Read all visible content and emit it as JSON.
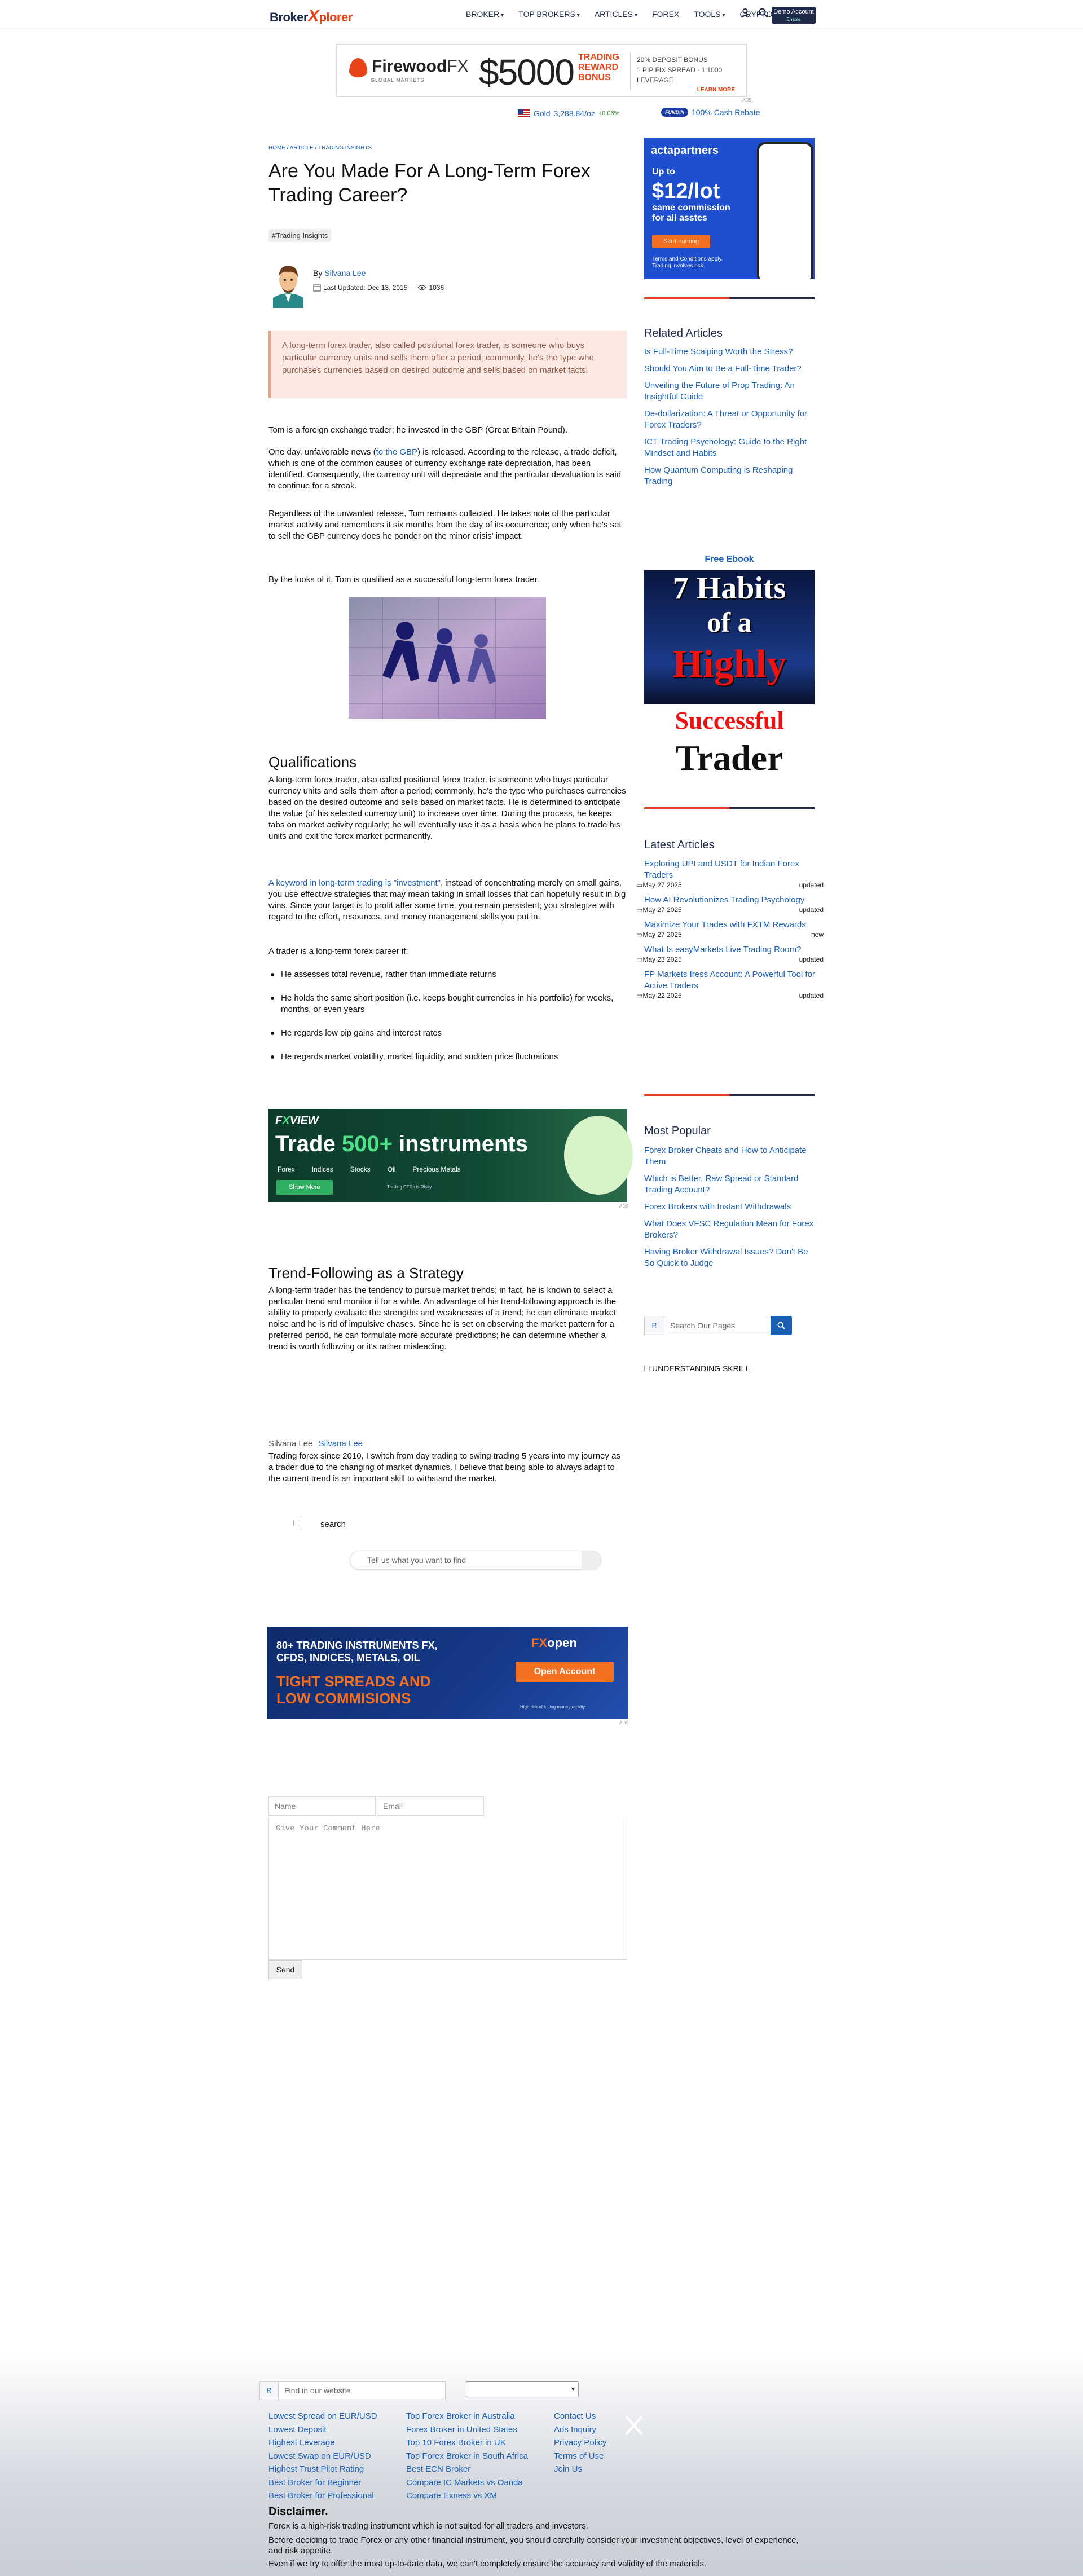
{
  "header": {
    "logo_part1": "Broker",
    "logo_x": "X",
    "logo_part2": "plorer",
    "nav": [
      {
        "label": "BROKER"
      },
      {
        "label": "TOP BROKERS"
      },
      {
        "label": "ARTICLES"
      },
      {
        "label": "FOREX"
      },
      {
        "label": "TOOLS"
      },
      {
        "label": "CRYPTO"
      }
    ],
    "demo_label": "Demo Account",
    "demo_sub": "Enable",
    "icons": [
      "user-icon",
      "search-icon",
      "menu-icon"
    ]
  },
  "top_banner": {
    "brand": "Firewood",
    "brand_fx": "FX",
    "brand_sub": "GLOBAL MARKETS",
    "amount": "$5000",
    "headline": [
      "TRADING",
      "REWARD",
      "BONUS"
    ],
    "lines": [
      "20% DEPOSIT BONUS",
      "1 PIP FIX SPREAD · 1:1000 LEVERAGE"
    ],
    "learn_more": "LEARN MORE",
    "ad_tag": "ADS"
  },
  "ticker": {
    "gold_label": "Gold",
    "gold_value": "3,288.84/oz",
    "gold_change": "+0.06%",
    "rebate_badge": "FUNDIN",
    "rebate_text": "100% Cash Rebate"
  },
  "article": {
    "breadcrumb": "HOME / ARTICLE / TRADING INSIGHTS",
    "title": "Are You Made For A Long-Term Forex Trading Career?",
    "tag": "#Trading Insights",
    "by": "By",
    "author": "Silvana Lee",
    "last_updated": "Last Updated: Dec 13, 2015",
    "views": "1036",
    "callout": "A long-term forex trader, also called positional forex trader, is someone who buys particular currency units and sells them after a period; commonly, he's the type who purchases currencies based on desired outcome and sells based on market facts.",
    "p1": "Tom is a foreign exchange trader; he invested in the GBP (Great Britain Pound).",
    "p2_a": "One day, unfavorable news (",
    "p2_link": "to the GBP",
    "p2_b": ") is released. According to the release, a trade deficit, which is one of the common causes of currency exchange rate depreciation, has been identified. Consequently, the currency unit will depreciate and the particular devaluation is said to continue for a streak.",
    "p3": "Regardless of the unwanted release, Tom remains collected. He takes note of the particular market activity and remembers it six months from the day of its occurrence; only when he's set to sell the GBP currency does he ponder on the minor crisis' impact.",
    "p4": "By the looks of it, Tom is qualified as a successful long-term forex trader.",
    "h_qualifications": "Qualifications",
    "p5": "A long-term forex trader, also called positional forex trader, is someone who buys particular currency units and sells them after a period; commonly, he's the type who purchases currencies based on the desired outcome and sells based on market facts. He is determined to anticipate the value (of his selected currency unit) to increase over time. During the process, he keeps tabs on market activity regularly; he will eventually use it as a basis when he plans to trade his units and exit the forex market permanently.",
    "p6_link": "A keyword in long-term trading is \"investment\"",
    "p6_b": ", instead of concentrating merely on small gains, you use effective strategies that may mean taking in small losses that can hopefully result in big wins. Since your target is to profit after some time, you remain persistent; you strategize with regard to the effort, resources, and money management skills you put in.",
    "p7": "A trader is a long-term forex career if:",
    "bullets": [
      "He assesses total revenue, rather than immediate returns",
      "He holds the same short position (i.e. keeps bought currencies in his portfolio) for weeks, months, or even years",
      "He regards low pip gains and interest rates",
      "He regards market volatility, market liquidity, and sudden price fluctuations"
    ],
    "h_trend": "Trend-Following as a Strategy",
    "p8": "A long-term trader has the tendency to pursue market trends; in fact, he is known to select a particular trend and monitor it for a while. An advantage of his trend-following approach is the ability to properly evaluate the strengths and weaknesses of a trend; he can eliminate market noise and he is rid of impulsive chases. Since he is set on observing the market pattern for a preferred period, he can formulate more accurate predictions; he can determine whether a trend is worth following or it's rather misleading."
  },
  "fxview_banner": {
    "brand_a": "F",
    "brand_b": "X",
    "brand_c": "VIEW",
    "headline_a": "Trade ",
    "headline_b": "500+",
    "headline_c": " instruments",
    "cats": [
      "Forex",
      "Indices",
      "Stocks",
      "Oil",
      "Precious Metals"
    ],
    "button": "Show More",
    "risk": "Trading CFDs is Risky",
    "ad_tag": "ADS"
  },
  "author_box": {
    "img_alt": "Silvana Lee",
    "name": "Silvana Lee",
    "bio": "Trading forex since 2010, I switch from day trading to swing trading 5 years into my journey as a trader due to the changing of market dynamics. I believe that being able to always adapt to the current trend is an important skill to withstand the market."
  },
  "search_area": {
    "img_alt": "search",
    "placeholder": "Tell us what you want to find"
  },
  "fxopen_banner": {
    "line1": "80+ TRADING INSTRUMENTS FX,",
    "line2": "CFDS, INDICES, METALS, OIL",
    "line3": "TIGHT SPREADS AND",
    "line4": "LOW COMMISIONS",
    "logo_a": "FX",
    "logo_b": "open",
    "button": "Open Account",
    "risk": "High risk of losing money rapidly.",
    "ad_tag": "ADS"
  },
  "comment_form": {
    "name_ph": "Name",
    "email_ph": "Email",
    "comment_ph": "Give Your Comment Here",
    "send": "Send"
  },
  "sidebar": {
    "acta": {
      "brand": "actapartners",
      "up_to": "Up to",
      "price": "$12/lot",
      "same": "same commission",
      "same2": "for all asstes",
      "button": "Start earning",
      "terms1": "Terms and Conditions apply.",
      "terms2": "Trading involves risk."
    },
    "related_heading": "Related Articles",
    "related": [
      "Is Full-Time Scalping Worth the Stress?",
      "Should You Aim to Be a Full-Time Trader?",
      "Unveiling the Future of Prop Trading: An Insightful Guide",
      "De-dollarization: A Threat or Opportunity for Forex Traders?",
      "ICT Trading Psychology: Guide to the Right Mindset and Habits",
      "How Quantum Computing is Reshaping Trading"
    ],
    "ebook_heading": "Free Ebook",
    "ebook": {
      "l1": "7 Habits",
      "l2": "of a",
      "l3": "Highly",
      "l4": "Successful",
      "l5": "Trader"
    },
    "latest_heading": "Latest Articles",
    "latest": [
      {
        "title": "Exploring UPI and USDT for Indian Forex Traders",
        "date": "May 27 2025",
        "status": "updated"
      },
      {
        "title": "How AI Revolutionizes Trading Psychology",
        "date": "May 27 2025",
        "status": "updated"
      },
      {
        "title": "Maximize Your Trades with FXTM Rewards",
        "date": "May 27 2025",
        "status": "new"
      },
      {
        "title": "What Is easyMarkets Live Trading Room?",
        "date": "May 23 2025",
        "status": "updated"
      },
      {
        "title": "FP Markets Iress Account: A Powerful Tool for Active Traders",
        "date": "May 22 2025",
        "status": "updated"
      }
    ],
    "popular_heading": "Most Popular",
    "popular": [
      "Forex Broker Cheats and How to Anticipate Them",
      "Which is Better, Raw Spread or Standard Trading Account?",
      "Forex Brokers with Instant Withdrawals",
      "What Does VFSC Regulation Mean for Forex Brokers?",
      "Having Broker Withdrawal Issues? Don't Be So Quick to Judge"
    ],
    "search_ph": "Search Our Pages",
    "skrill_alt": "UNDERSTANDING SKRILL"
  },
  "footer": {
    "search_ph": "Find in our website",
    "col1": [
      "Lowest Spread on EUR/USD",
      "Lowest Deposit",
      "Highest Leverage",
      "Lowest Swap on EUR/USD",
      "Highest Trust Pilot Rating",
      "Best Broker for Beginner",
      "Best Broker for Professional"
    ],
    "col2": [
      "Top Forex Broker in Australia",
      "Forex Broker in United States",
      "Top 10 Forex Broker in UK",
      "Top Forex Broker in South Africa",
      "Best ECN Broker",
      "Compare IC Markets vs Oanda",
      "Compare Exness vs XM"
    ],
    "col3": [
      "Contact Us",
      "Ads Inquiry",
      "Privacy Policy",
      "Terms of Use",
      "Join Us"
    ],
    "disclaimer_heading": "Disclaimer.",
    "disclaimer1": "Forex is a high-risk trading instrument which is not suited for all traders and investors.",
    "disclaimer2": "Before deciding to trade Forex or any other financial instrument, you should carefully consider your investment objectives, level of experience, and risk appetite.",
    "disclaimer3": "Even if we try to offer the most up-to-date data, we can't completely ensure the accuracy and validity of the materials."
  }
}
